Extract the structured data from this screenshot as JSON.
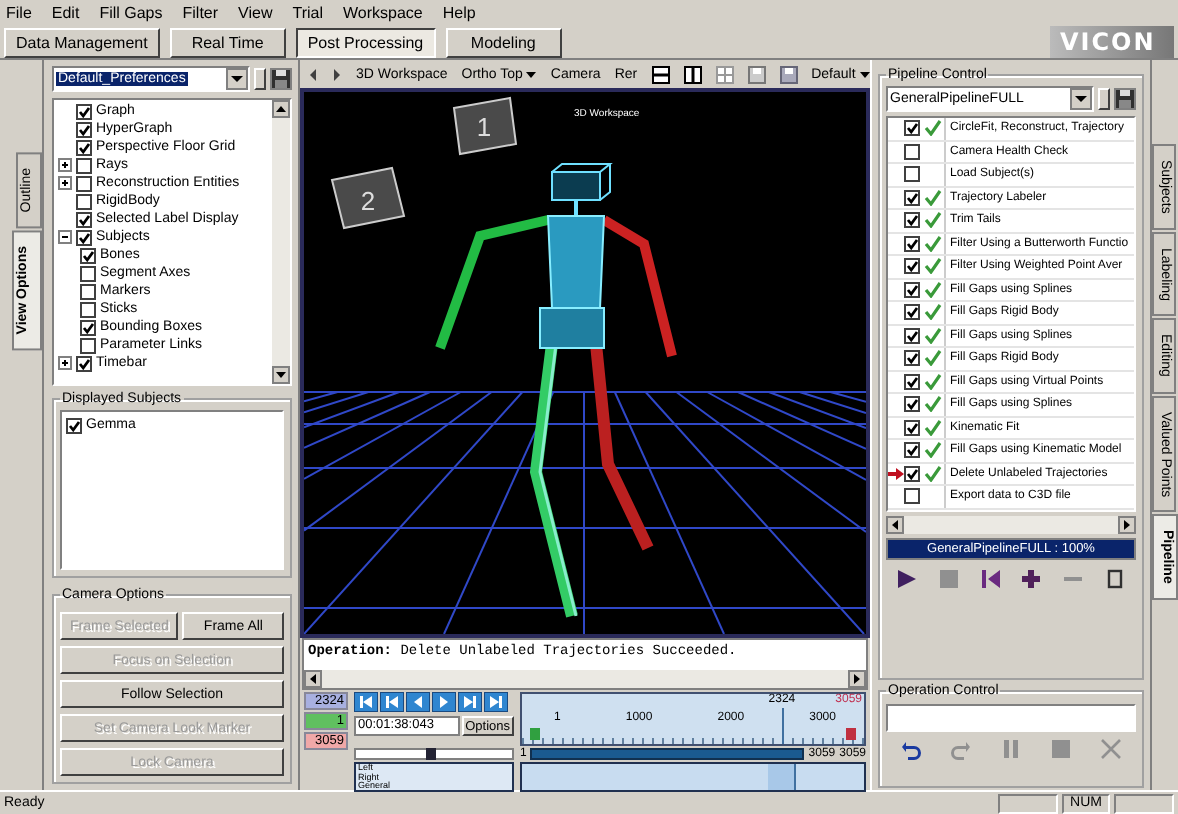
{
  "menu": [
    "File",
    "Edit",
    "Fill Gaps",
    "Filter",
    "View",
    "Trial",
    "Workspace",
    "Help"
  ],
  "mode_tabs": [
    {
      "label": "Data Management",
      "selected": false
    },
    {
      "label": "Real Time",
      "selected": false
    },
    {
      "label": "Post Processing",
      "selected": true
    },
    {
      "label": "Modeling",
      "selected": false
    }
  ],
  "logo": "VICON",
  "left_tabs": [
    {
      "label": "Outline",
      "selected": false
    },
    {
      "label": "View Options",
      "selected": true
    }
  ],
  "view_options": {
    "preset": "Default_Preferences",
    "tree": [
      {
        "label": "Graph",
        "checked": true
      },
      {
        "label": "HyperGraph",
        "checked": true
      },
      {
        "label": "Perspective Floor Grid",
        "checked": true
      },
      {
        "label": "Rays",
        "checked": false,
        "expanded": false
      },
      {
        "label": "Reconstruction Entities",
        "checked": false,
        "expanded": false
      },
      {
        "label": "RigidBody",
        "checked": false
      },
      {
        "label": "Selected Label Display",
        "checked": true
      },
      {
        "label": "Subjects",
        "checked": true,
        "expanded": true,
        "children": [
          {
            "label": "Bones",
            "checked": true
          },
          {
            "label": "Segment Axes",
            "checked": false
          },
          {
            "label": "Markers",
            "checked": false
          },
          {
            "label": "Sticks",
            "checked": false
          },
          {
            "label": "Bounding Boxes",
            "checked": true
          },
          {
            "label": "Parameter Links",
            "checked": false
          }
        ]
      },
      {
        "label": "Timebar",
        "checked": true,
        "expanded": false
      }
    ],
    "displayed_subjects": {
      "title": "Displayed Subjects",
      "items": [
        {
          "label": "Gemma",
          "checked": true
        }
      ]
    },
    "camera_options": {
      "title": "Camera Options",
      "rows": [
        [
          {
            "label": "Frame Selected",
            "disabled": true
          },
          {
            "label": "Frame All",
            "disabled": false
          }
        ],
        [
          {
            "label": "Focus on Selection",
            "disabled": true
          }
        ],
        [
          {
            "label": "Follow Selection",
            "disabled": false
          }
        ],
        [
          {
            "label": "Set Camera Look Marker",
            "disabled": true
          }
        ],
        [
          {
            "label": "Lock Camera",
            "disabled": true
          }
        ]
      ]
    }
  },
  "viewport": {
    "toolbar": [
      {
        "label": "3D Workspace",
        "dropdown": false
      },
      {
        "label": "Ortho Top",
        "dropdown": true
      },
      {
        "label": "Camera",
        "dropdown": false
      },
      {
        "label": "Rer",
        "dropdown": false
      }
    ],
    "layout": {
      "label": "Default",
      "dropdown": true
    },
    "view_label": "3D Workspace",
    "cameras": [
      "1",
      "2"
    ],
    "operation": "**Operation:** Delete Unlabeled Trajectories Succeeded."
  },
  "timeline": {
    "frames": [
      {
        "kind": "current",
        "value": "2324"
      },
      {
        "kind": "start",
        "value": "1"
      },
      {
        "kind": "end",
        "value": "3059"
      }
    ],
    "timecode": "00:01:38:043",
    "options": "Options",
    "scrub": {
      "level": 0.48
    },
    "ruler_labels": [
      "1",
      "1000",
      "2000",
      "3000"
    ],
    "cursor": {
      "label": "2324",
      "level": 0.76
    },
    "end_label": "3059",
    "range": {
      "start": "1",
      "end": "3059",
      "max": "3059"
    },
    "tracks": [
      "Left",
      "Right",
      "General"
    ]
  },
  "pipeline": {
    "title": "Pipeline Control",
    "preset": "GeneralPipelineFULL",
    "steps": [
      {
        "label": "CircleFit, Reconstruct, Trajectory",
        "checked": true,
        "done": true,
        "current": false
      },
      {
        "label": "Camera Health Check",
        "checked": false,
        "done": false,
        "current": false
      },
      {
        "label": "Load Subject(s)",
        "checked": false,
        "done": false,
        "current": false
      },
      {
        "label": "Trajectory Labeler",
        "checked": true,
        "done": true,
        "current": false
      },
      {
        "label": "Trim Tails",
        "checked": true,
        "done": true,
        "current": false
      },
      {
        "label": "Filter Using a Butterworth Functio",
        "checked": true,
        "done": true,
        "current": false
      },
      {
        "label": "Filter Using Weighted Point Aver",
        "checked": true,
        "done": true,
        "current": false
      },
      {
        "label": "Fill Gaps using Splines",
        "checked": true,
        "done": true,
        "current": false
      },
      {
        "label": "Fill Gaps Rigid Body",
        "checked": true,
        "done": true,
        "current": false
      },
      {
        "label": "Fill Gaps using Splines",
        "checked": true,
        "done": true,
        "current": false
      },
      {
        "label": "Fill Gaps Rigid Body",
        "checked": true,
        "done": true,
        "current": false
      },
      {
        "label": "Fill Gaps using Virtual Points",
        "checked": true,
        "done": true,
        "current": false
      },
      {
        "label": "Fill Gaps using Splines",
        "checked": true,
        "done": true,
        "current": false
      },
      {
        "label": "Kinematic Fit",
        "checked": true,
        "done": true,
        "current": false
      },
      {
        "label": "Fill Gaps using Kinematic Model",
        "checked": true,
        "done": true,
        "current": false
      },
      {
        "label": "Delete Unlabeled Trajectories",
        "checked": true,
        "done": true,
        "current": true
      },
      {
        "label": "Export data to C3D file",
        "checked": false,
        "done": false,
        "current": false
      }
    ],
    "progress": {
      "label": "GeneralPipelineFULL : 100%",
      "level": 1
    },
    "operation_title": "Operation Control"
  },
  "right_tabs": [
    {
      "label": "Subjects",
      "selected": false
    },
    {
      "label": "Labeling",
      "selected": false
    },
    {
      "label": "Editing",
      "selected": false
    },
    {
      "label": "Valued Points",
      "selected": false
    },
    {
      "label": "Pipeline",
      "selected": true
    }
  ],
  "status_bar": {
    "message": "Ready",
    "indicator": "NUM"
  }
}
